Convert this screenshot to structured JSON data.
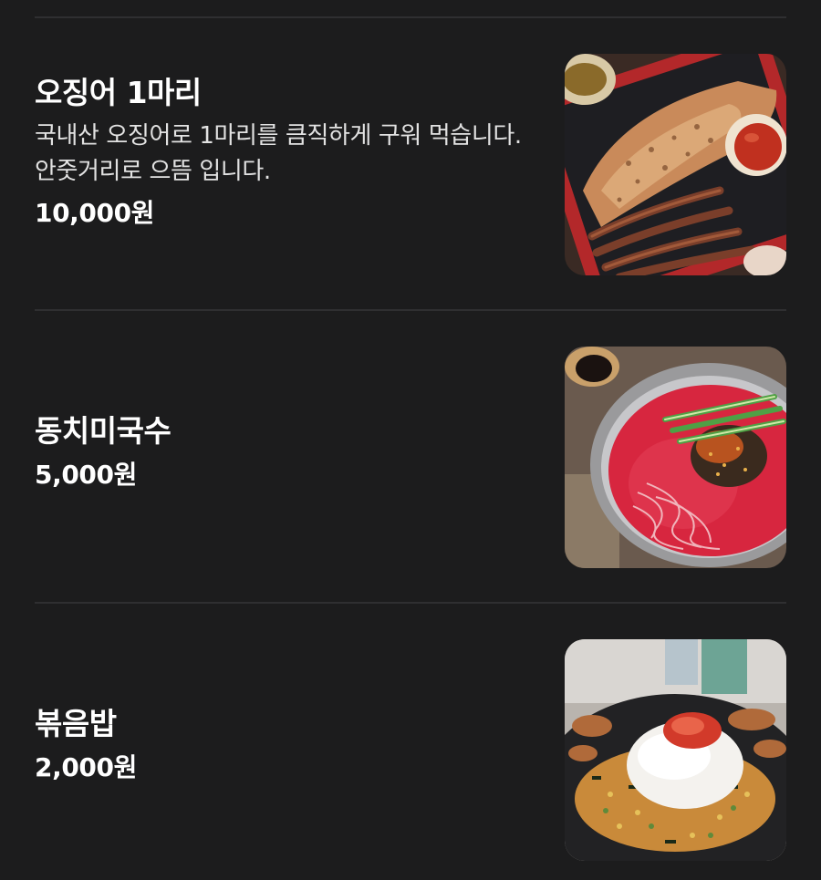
{
  "menu": {
    "items": [
      {
        "name": "오징어 1마리",
        "description": "국내산 오징어로 1마리를 큼직하게 구워 먹습니다. 안줏거리로 으뜸 입니다.",
        "price": "10,000원",
        "photo_icon": "grilled-squid-photo"
      },
      {
        "name": "동치미국수",
        "price": "5,000원",
        "photo_icon": "cold-noodle-soup-photo"
      },
      {
        "name": "볶음밥",
        "price": "2,000원",
        "photo_icon": "fried-rice-photo"
      }
    ]
  },
  "colors": {
    "background": "#1c1c1d",
    "divider": "#2f2f31",
    "text_primary": "#ffffff",
    "text_secondary": "#e2e2e2"
  }
}
